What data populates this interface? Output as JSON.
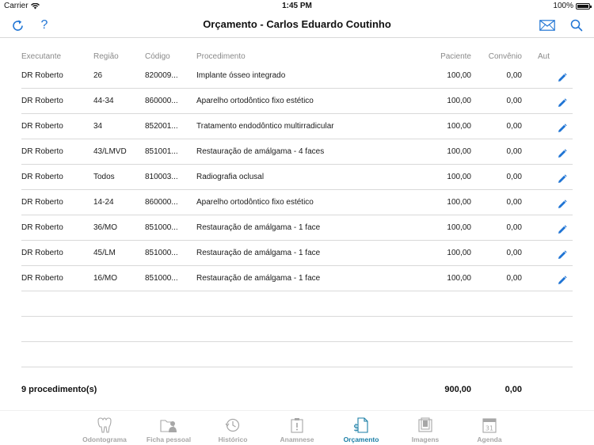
{
  "status_bar": {
    "carrier": "Carrier",
    "time": "1:45 PM",
    "battery": "100%",
    "battery_level": 1.0
  },
  "nav": {
    "title": "Orçamento - Carlos Eduardo Coutinho",
    "help_label": "?"
  },
  "table": {
    "headers": {
      "executante": "Executante",
      "regiao": "Região",
      "codigo": "Código",
      "procedimento": "Procedimento",
      "paciente": "Paciente",
      "convenio": "Convênio",
      "aut": "Aut"
    },
    "rows": [
      {
        "executante": "DR Roberto",
        "regiao": "26",
        "codigo": "820009...",
        "procedimento": "Implante ósseo integrado",
        "paciente": "100,00",
        "convenio": "0,00"
      },
      {
        "executante": "DR Roberto",
        "regiao": "44-34",
        "codigo": "860000...",
        "procedimento": "Aparelho ortodôntico fixo estético",
        "paciente": "100,00",
        "convenio": "0,00"
      },
      {
        "executante": "DR Roberto",
        "regiao": "34",
        "codigo": "852001...",
        "procedimento": "Tratamento endodôntico multirradicular",
        "paciente": "100,00",
        "convenio": "0,00"
      },
      {
        "executante": "DR Roberto",
        "regiao": "43/LMVD",
        "codigo": "851001...",
        "procedimento": "Restauração de amálgama - 4 faces",
        "paciente": "100,00",
        "convenio": "0,00"
      },
      {
        "executante": "DR Roberto",
        "regiao": "Todos",
        "codigo": "810003...",
        "procedimento": "Radiografia oclusal",
        "paciente": "100,00",
        "convenio": "0,00"
      },
      {
        "executante": "DR Roberto",
        "regiao": "14-24",
        "codigo": "860000...",
        "procedimento": "Aparelho ortodôntico fixo estético",
        "paciente": "100,00",
        "convenio": "0,00"
      },
      {
        "executante": "DR Roberto",
        "regiao": "36/MO",
        "codigo": "851000...",
        "procedimento": "Restauração de amálgama - 1 face",
        "paciente": "100,00",
        "convenio": "0,00"
      },
      {
        "executante": "DR Roberto",
        "regiao": "45/LM",
        "codigo": "851000...",
        "procedimento": "Restauração de amálgama - 1 face",
        "paciente": "100,00",
        "convenio": "0,00"
      },
      {
        "executante": "DR Roberto",
        "regiao": "16/MO",
        "codigo": "851000...",
        "procedimento": "Restauração de amálgama - 1 face",
        "paciente": "100,00",
        "convenio": "0,00"
      }
    ]
  },
  "totals": {
    "count_label": "9 procedimento(s)",
    "paciente": "900,00",
    "convenio": "0,00"
  },
  "tabs": [
    {
      "label": "Odontograma",
      "icon": "tooth-icon",
      "active": false
    },
    {
      "label": "Ficha pessoal",
      "icon": "folder-person-icon",
      "active": false
    },
    {
      "label": "Histórico",
      "icon": "history-icon",
      "active": false
    },
    {
      "label": "Anamnese",
      "icon": "clipboard-icon",
      "active": false
    },
    {
      "label": "Orçamento",
      "icon": "budget-icon",
      "active": true
    },
    {
      "label": "Imagens",
      "icon": "images-icon",
      "active": false
    },
    {
      "label": "Agenda",
      "icon": "calendar-icon",
      "active": false
    }
  ],
  "calendar_day": "31",
  "colors": {
    "accent": "#1f74d4",
    "active_tab": "#1a7ea6",
    "inactive_tab": "#a7a7a7"
  }
}
